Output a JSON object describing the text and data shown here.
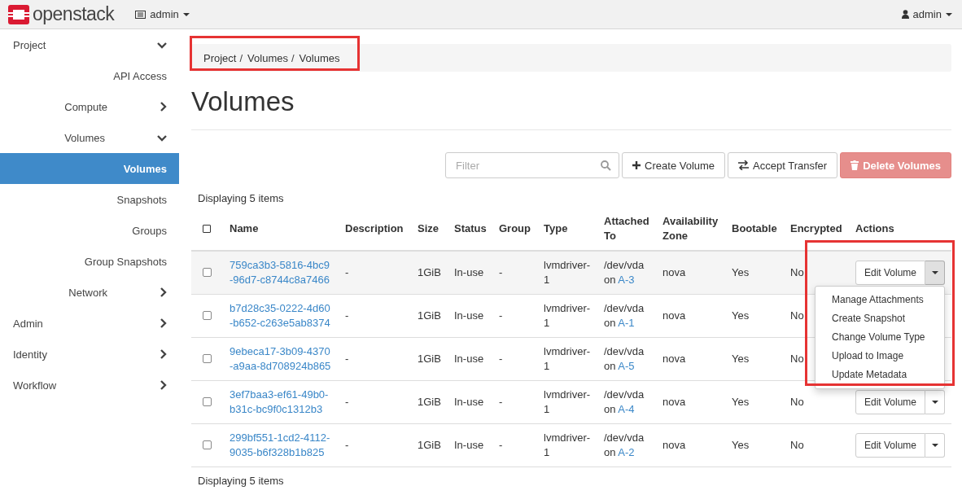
{
  "topbar": {
    "brand": "openstack",
    "project_menu": "admin",
    "user_menu": "admin"
  },
  "sidebar": {
    "items": [
      {
        "label": "Project",
        "expanded": true,
        "children": [
          {
            "label": "API Access",
            "selected": false
          },
          {
            "label": "Compute",
            "expanded": false
          },
          {
            "label": "Volumes",
            "expanded": true,
            "children": [
              {
                "label": "Volumes",
                "selected": true
              },
              {
                "label": "Snapshots",
                "selected": false
              },
              {
                "label": "Groups",
                "selected": false
              },
              {
                "label": "Group Snapshots",
                "selected": false
              }
            ]
          },
          {
            "label": "Network",
            "expanded": false
          }
        ]
      },
      {
        "label": "Admin",
        "expanded": false
      },
      {
        "label": "Identity",
        "expanded": false
      },
      {
        "label": "Workflow",
        "expanded": false
      }
    ]
  },
  "breadcrumb": {
    "highlighted": true,
    "separator": "/",
    "items": [
      "Project",
      "Volumes",
      "Volumes"
    ]
  },
  "title": "Volumes",
  "toolbar": {
    "filter": {
      "placeholder": "Filter"
    },
    "buttons": [
      {
        "kind": "create",
        "label": "Create Volume",
        "disabled": false
      },
      {
        "kind": "transfer",
        "label": "Accept Transfer",
        "disabled": false
      },
      {
        "kind": "delete",
        "label": "Delete Volumes",
        "disabled": true
      }
    ]
  },
  "count_top": "Displaying 5 items",
  "table": {
    "select_all_checked": false,
    "columns": [
      "Name",
      "Description",
      "Size",
      "Status",
      "Group",
      "Type",
      "Attached To",
      "Availability Zone",
      "Bootable",
      "Encrypted",
      "Actions"
    ],
    "rows": [
      {
        "checked": false,
        "name": "759ca3b3-5816-4bc9-96d7-c8744c8a7466",
        "description": "-",
        "size": "1GiB",
        "status": "In-use",
        "group": "-",
        "type": "lvmdriver-1",
        "attached_device": "/dev/vda",
        "attached_on": "on",
        "attached_server": "A-3",
        "zone": "nova",
        "bootable": "Yes",
        "encrypted": "No",
        "action": "Edit Volume",
        "menu_open": true
      },
      {
        "checked": false,
        "name": "b7d28c35-0222-4d60-b652-c263e5ab8374",
        "description": "-",
        "size": "1GiB",
        "status": "In-use",
        "group": "-",
        "type": "lvmdriver-1",
        "attached_device": "/dev/vda",
        "attached_on": "on",
        "attached_server": "A-1",
        "zone": "nova",
        "bootable": "Yes",
        "encrypted": "No"
      },
      {
        "checked": false,
        "name": "9ebeca17-3b09-4370-a9aa-8d708924b865",
        "description": "-",
        "size": "1GiB",
        "status": "In-use",
        "group": "-",
        "type": "lvmdriver-1",
        "attached_device": "/dev/vda",
        "attached_on": "on",
        "attached_server": "A-5",
        "zone": "nova",
        "bootable": "Yes",
        "encrypted": "No"
      },
      {
        "checked": false,
        "name": "3ef7baa3-ef61-49b0-b31c-bc9f0c1312b3",
        "description": "-",
        "size": "1GiB",
        "status": "In-use",
        "group": "-",
        "type": "lvmdriver-1",
        "attached_device": "/dev/vda",
        "attached_on": "on",
        "attached_server": "A-4",
        "zone": "nova",
        "bootable": "Yes",
        "encrypted": "No",
        "action": "Edit Volume",
        "menu_open": false
      },
      {
        "checked": false,
        "name": "299bf551-1cd2-4112-9035-b6f328b1b825",
        "description": "-",
        "size": "1GiB",
        "status": "In-use",
        "group": "-",
        "type": "lvmdriver-1",
        "attached_device": "/dev/vda",
        "attached_on": "on",
        "attached_server": "A-2",
        "zone": "nova",
        "bootable": "Yes",
        "encrypted": "No",
        "action": "Edit Volume",
        "menu_open": false
      }
    ]
  },
  "dropdown_menu": {
    "highlighted": true,
    "items": [
      "Manage Attachments",
      "Create Snapshot",
      "Change Volume Type",
      "Upload to Image",
      "Update Metadata"
    ]
  },
  "count_bottom": "Displaying 5 items"
}
